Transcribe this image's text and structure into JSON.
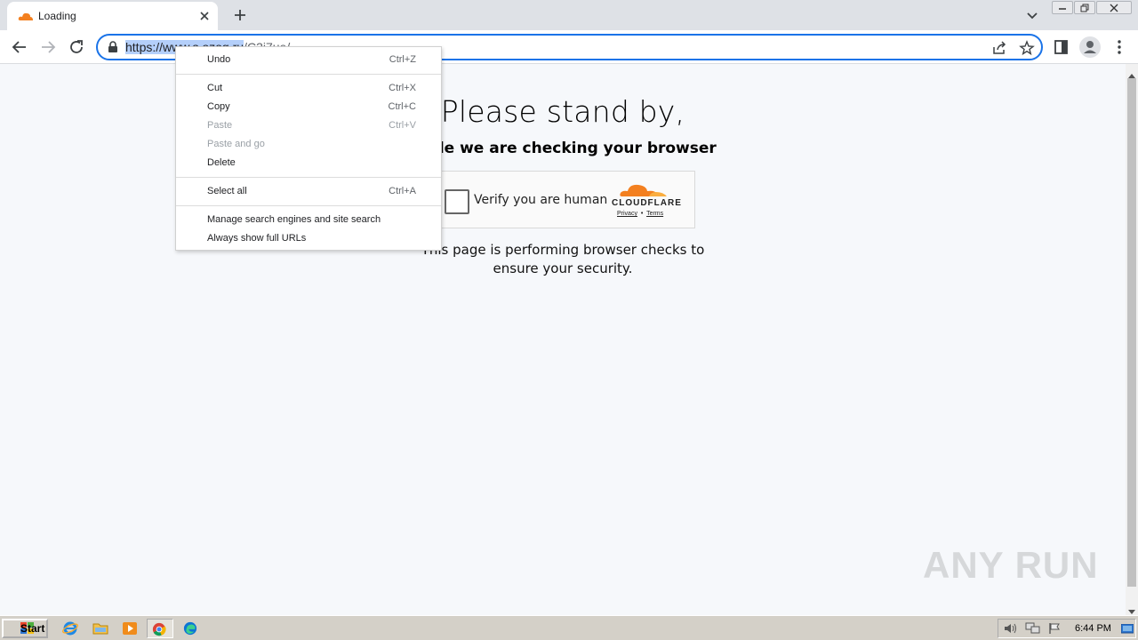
{
  "browser": {
    "tab": {
      "title": "Loading",
      "favicon": "cloudflare-cloud-icon"
    },
    "new_tab_icon": "plus-icon",
    "address_bar": {
      "url_selected": "https://www.s.ozog.ru",
      "url_rest": "/C3i7ue/",
      "lock_icon": "lock-icon"
    }
  },
  "page": {
    "heading": "Please stand by,",
    "subheading": "while we are checking your browser",
    "captcha": {
      "label": "Verify you are human",
      "brand": "CLOUDFLARE",
      "privacy_link": "Privacy",
      "separator": "•",
      "terms_link": "Terms",
      "brand_color": "#f38020"
    },
    "security_text": "This page is performing browser checks to ensure your security.",
    "watermark": "ANY RUN"
  },
  "context_menu": {
    "groups": [
      [
        {
          "label": "Undo",
          "shortcut": "Ctrl+Z",
          "disabled": false
        }
      ],
      [
        {
          "label": "Cut",
          "shortcut": "Ctrl+X",
          "disabled": false
        },
        {
          "label": "Copy",
          "shortcut": "Ctrl+C",
          "disabled": false
        },
        {
          "label": "Paste",
          "shortcut": "Ctrl+V",
          "disabled": true
        },
        {
          "label": "Paste and go",
          "shortcut": "",
          "disabled": true
        },
        {
          "label": "Delete",
          "shortcut": "",
          "disabled": false
        }
      ],
      [
        {
          "label": "Select all",
          "shortcut": "Ctrl+A",
          "disabled": false
        }
      ],
      [
        {
          "label": "Manage search engines and site search",
          "shortcut": "",
          "disabled": false
        },
        {
          "label": "Always show full URLs",
          "shortcut": "",
          "disabled": false
        }
      ]
    ]
  },
  "taskbar": {
    "start_label": "Start",
    "apps": [
      "internet-explorer-icon",
      "file-explorer-icon",
      "media-player-icon",
      "chrome-icon",
      "edge-icon"
    ],
    "clock": "6:44 PM"
  }
}
